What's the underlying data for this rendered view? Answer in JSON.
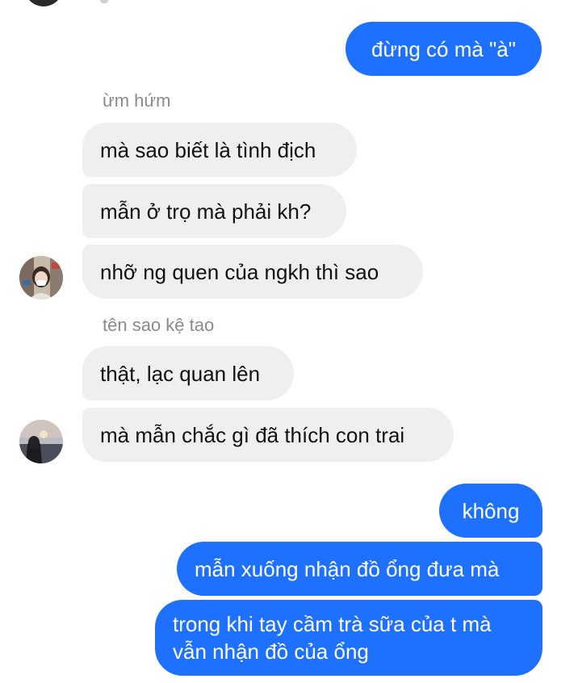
{
  "messages": {
    "m1": "đừng có mà \"à\"",
    "reply1": "ừm hứm",
    "m2": "mà sao biết là tình địch",
    "m3": "mẫn ở trọ mà phải kh?",
    "m4": "nhỡ ng quen của ngkh thì sao",
    "reply2": "tên sao kệ tao",
    "m5": "thật, lạc quan lên",
    "m6": "mà mẫn chắc gì đã thích con trai",
    "m7": "không",
    "m8": "mẫn xuống nhận đồ ổng đưa mà",
    "m9_line1": "trong khi tay cầm trà sữa của t mà",
    "m9_line2": "vẫn nhận đồ của ổng"
  },
  "colors": {
    "outgoing_bubble": "#1e70ff",
    "incoming_bubble": "#efefef",
    "reply_label": "#8a8a8a"
  }
}
